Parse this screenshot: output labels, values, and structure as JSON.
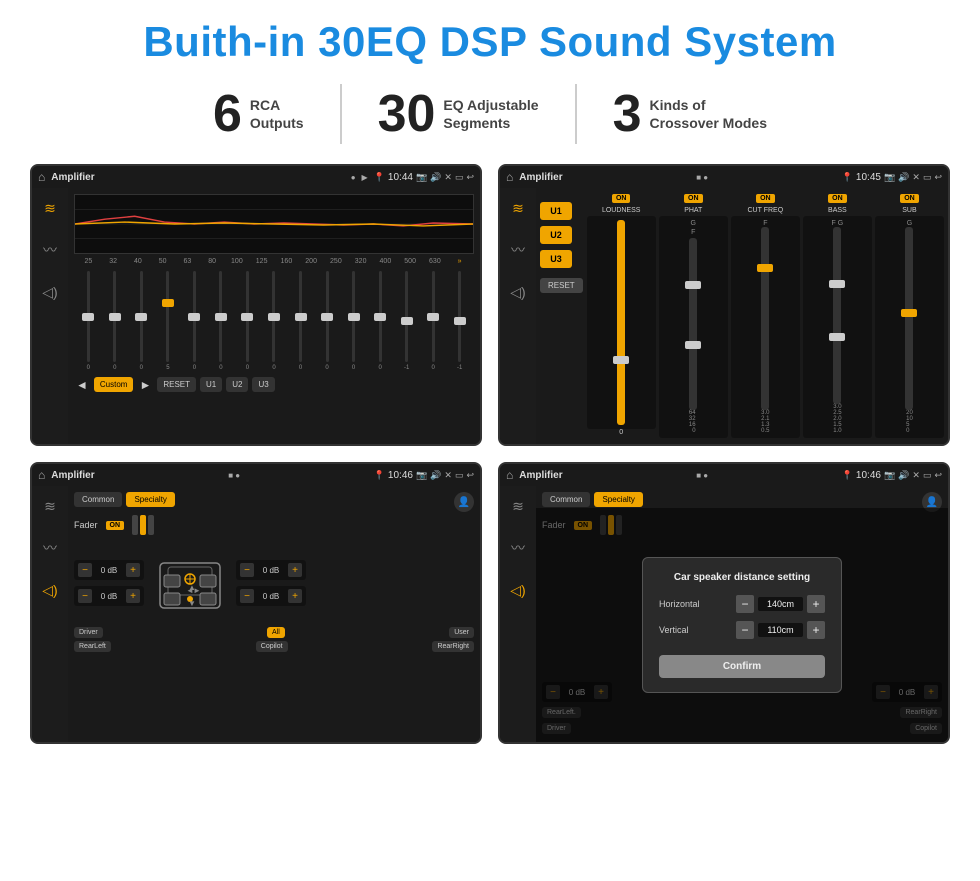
{
  "page": {
    "title": "Buith-in 30EQ DSP Sound System",
    "stats": [
      {
        "number": "6",
        "text": "RCA\nOutputs"
      },
      {
        "number": "30",
        "text": "EQ Adjustable\nSegments"
      },
      {
        "number": "3",
        "text": "Kinds of\nCrossover Modes"
      }
    ],
    "screens": [
      {
        "id": "eq-screen",
        "status_time": "10:44",
        "app_title": "Amplifier",
        "eq_freqs": [
          "25",
          "32",
          "40",
          "50",
          "63",
          "80",
          "100",
          "125",
          "160",
          "200",
          "250",
          "320",
          "400",
          "500",
          "630"
        ],
        "eq_values": [
          "0",
          "0",
          "0",
          "5",
          "0",
          "0",
          "0",
          "0",
          "0",
          "0",
          "0",
          "0",
          "-1",
          "0",
          "-1"
        ],
        "preset": "Custom",
        "bottom_btns": [
          "U1",
          "U2",
          "U3"
        ]
      },
      {
        "id": "crossover-screen",
        "status_time": "10:45",
        "app_title": "Amplifier",
        "u_buttons": [
          "U1",
          "U2",
          "U3"
        ],
        "channels": [
          {
            "label": "LOUDNESS",
            "on": true
          },
          {
            "label": "PHAT",
            "on": true
          },
          {
            "label": "CUT FREQ",
            "on": true
          },
          {
            "label": "BASS",
            "on": true
          },
          {
            "label": "SUB",
            "on": true
          }
        ],
        "reset_label": "RESET"
      },
      {
        "id": "speaker-screen",
        "status_time": "10:46",
        "app_title": "Amplifier",
        "tabs": [
          "Common",
          "Specialty"
        ],
        "active_tab": "Specialty",
        "fader_label": "Fader",
        "fader_on": "ON",
        "vol_controls": [
          {
            "label": "",
            "value": "0 dB"
          },
          {
            "label": "",
            "value": "0 dB"
          },
          {
            "label": "",
            "value": "0 dB"
          },
          {
            "label": "",
            "value": "0 dB"
          }
        ],
        "bottom_labels": [
          "Driver",
          "",
          "Copilot",
          "RearLeft",
          "All",
          "",
          "User",
          "RearRight"
        ]
      },
      {
        "id": "dialog-screen",
        "status_time": "10:46",
        "app_title": "Amplifier",
        "dialog": {
          "title": "Car speaker distance setting",
          "fields": [
            {
              "label": "Horizontal",
              "value": "140cm"
            },
            {
              "label": "Vertical",
              "value": "110cm"
            }
          ],
          "confirm_label": "Confirm"
        },
        "bottom_labels_visible": [
          "Driver",
          "Copilot",
          "RearLeft.",
          "RearRight"
        ]
      }
    ]
  }
}
